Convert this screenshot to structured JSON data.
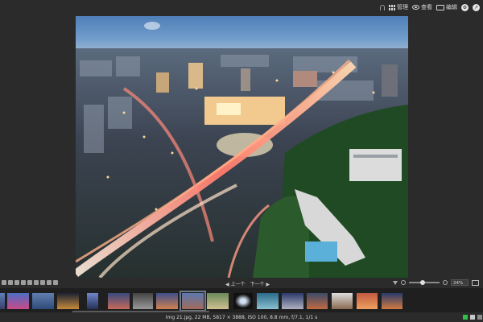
{
  "topbar": {
    "grid_label": "管理",
    "view_label": "查看",
    "edit_label": "编辑"
  },
  "toolbar": {
    "prev_label": "◀ 上一个",
    "next_label": "下一个 ▶",
    "zoom_value": "24%"
  },
  "status": {
    "text": "Img 21.jpg, 22 MB, 5817 × 3888, ISO 100, 8.8 mm, f/7.1, 1/1 s"
  },
  "colors": {
    "accent_green": "#2fbf4a",
    "panel": "#2b2b2b",
    "filmstrip": "#1f1f1f"
  }
}
